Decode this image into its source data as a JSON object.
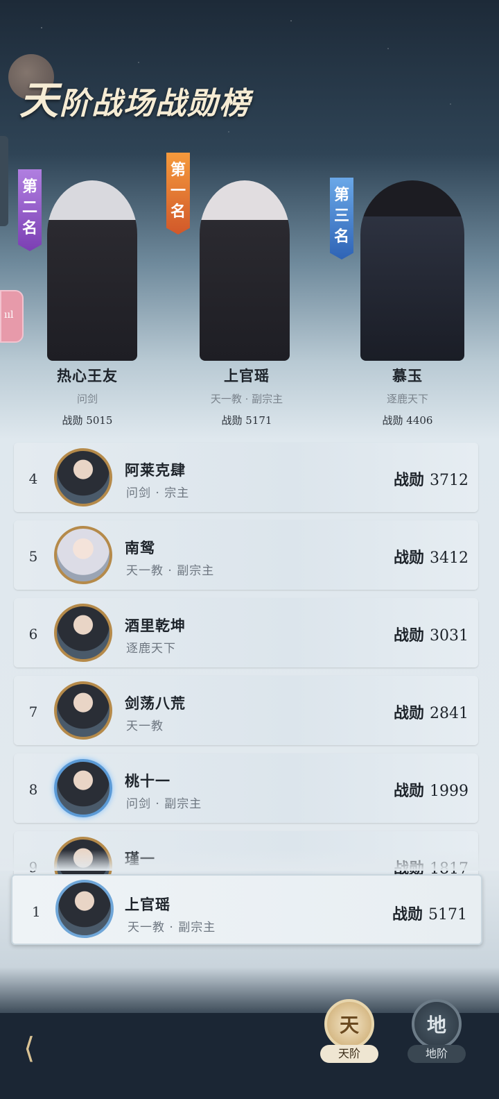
{
  "title": {
    "lead": "天",
    "rest": "阶战场战勋榜"
  },
  "podium": [
    {
      "banner": "第二名",
      "name": "热心王友",
      "guild": "问剑",
      "score": "战勋 5015"
    },
    {
      "banner": "第一名",
      "name": "上官瑶",
      "guild": "天一教 · 副宗主",
      "score": "战勋 5171"
    },
    {
      "banner": "第三名",
      "name": "慕玉",
      "guild": "逐鹿天下",
      "score": "战勋 4406"
    }
  ],
  "rows": [
    {
      "rank": "4",
      "name": "阿莱克肆",
      "guild": "问剑 · 宗主",
      "score_label": "战勋",
      "score": "3712"
    },
    {
      "rank": "5",
      "name": "南鸳",
      "guild": "天一教 · 副宗主",
      "score_label": "战勋",
      "score": "3412"
    },
    {
      "rank": "6",
      "name": "酒里乾坤",
      "guild": "逐鹿天下",
      "score_label": "战勋",
      "score": "3031"
    },
    {
      "rank": "7",
      "name": "剑荡八荒",
      "guild": "天一教",
      "score_label": "战勋",
      "score": "2841"
    },
    {
      "rank": "8",
      "name": "桃十一",
      "guild": "问剑 · 副宗主",
      "score_label": "战勋",
      "score": "1999"
    },
    {
      "rank": "9",
      "name": "瑾一",
      "guild": "",
      "score_label": "战勋",
      "score": "1817"
    }
  ],
  "self": {
    "rank": "1",
    "name": "上官瑶",
    "guild": "天一教 · 副宗主",
    "score_label": "战勋",
    "score": "5171"
  },
  "tabs": {
    "tian": {
      "glyph": "天",
      "label": "天阶"
    },
    "di": {
      "glyph": "地",
      "label": "地阶"
    }
  },
  "icons": {
    "back": "back-arrow-icon",
    "side": "music-bars-icon"
  }
}
